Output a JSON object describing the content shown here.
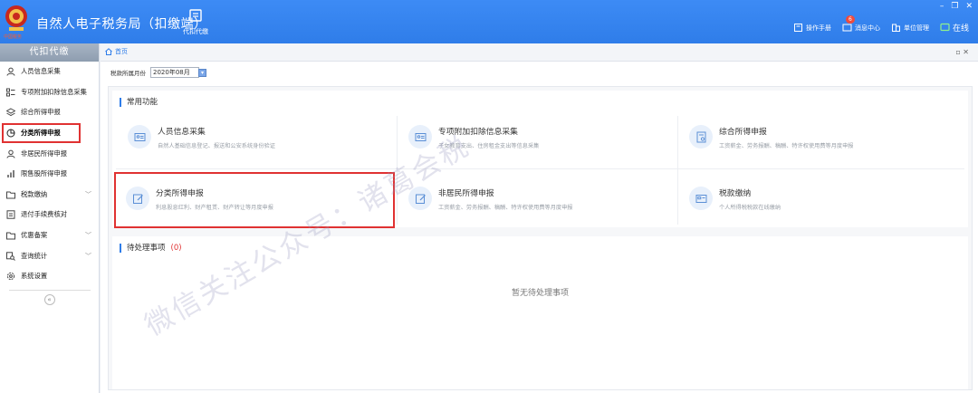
{
  "app": {
    "logo_text": "中国税务",
    "title": "自然人电子税务局（扣缴端）",
    "top_tab": "代扣代缴"
  },
  "header": {
    "manual": "操作手册",
    "messages": "消息中心",
    "message_badge": "6",
    "unit": "单位管理",
    "online": "在线"
  },
  "sidebar": {
    "heading": "代扣代缴",
    "items": [
      {
        "label": "人员信息采集",
        "icon": "person-icon"
      },
      {
        "label": "专项附加扣除信息采集",
        "icon": "list-icon"
      },
      {
        "label": "综合所得申报",
        "icon": "layers-icon"
      },
      {
        "label": "分类所得申报",
        "icon": "pie-icon"
      },
      {
        "label": "非居民所得申报",
        "icon": "person-icon"
      },
      {
        "label": "限售股所得申报",
        "icon": "bars-icon"
      },
      {
        "label": "税款缴纳",
        "icon": "folder-icon"
      },
      {
        "label": "退付手续费核对",
        "icon": "doc-icon"
      },
      {
        "label": "优惠备案",
        "icon": "folder-icon"
      },
      {
        "label": "查询统计",
        "icon": "search-icon"
      },
      {
        "label": "系统设置",
        "icon": "gear-icon"
      }
    ]
  },
  "main": {
    "home_tab": "首页",
    "period_label": "税款所属月份",
    "period_value": "2020年08月",
    "common_title": "常用功能",
    "cards": [
      {
        "title": "人员信息采集",
        "desc": "自然人基础信息登记、报送和公安系统身份验证"
      },
      {
        "title": "专项附加扣除信息采集",
        "desc": "子女教育支出、住房租金支出等信息采集"
      },
      {
        "title": "综合所得申报",
        "desc": "工资薪金、劳务报酬、稿酬、特许权使用费等月度申报"
      },
      {
        "title": "分类所得申报",
        "desc": "利息股息红利、财产租赁、财产转让等月度申报"
      },
      {
        "title": "非居民所得申报",
        "desc": "工资薪金、劳务报酬、稿酬、特许权使用费等月度申报"
      },
      {
        "title": "税款缴纳",
        "desc": "个人所得税税款在线缴纳"
      }
    ],
    "pending_title": "待处理事项",
    "pending_count": "(0)",
    "pending_empty": "暂无待处理事项"
  },
  "watermark": "微信关注公众号：诸葛会税",
  "colors": {
    "accent": "#2f7de9",
    "highlight": "#e03232"
  }
}
